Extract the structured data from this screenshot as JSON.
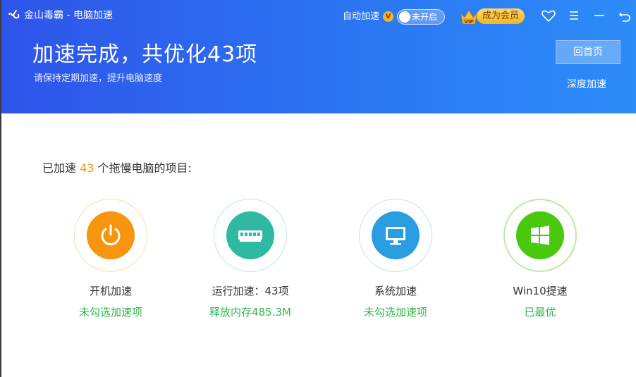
{
  "app": {
    "title": "金山毒霸 - 电脑加速"
  },
  "titlebar": {
    "auto_accelerate_label": "自动加速",
    "auto_vip_badge": "V",
    "toggle_state_label": "未开启",
    "vip_button_label": "成为会员",
    "vip_crown_text": "VIP"
  },
  "header": {
    "title": "加速完成，共优化43项",
    "subtitle": "请保持定期加速，提升电脑速度",
    "home_button": "回首页",
    "deep_accelerate": "深度加速"
  },
  "summary": {
    "prefix": "已加速 ",
    "count": "43",
    "suffix": " 个拖慢电脑的项目:"
  },
  "items": [
    {
      "name": "开机加速",
      "status": "未勾选加速项",
      "icon": "power-icon",
      "color": "#f7950e"
    },
    {
      "name": "运行加速：43项",
      "status": "释放内存485.3M",
      "icon": "memory-icon",
      "color": "#2fb9a2"
    },
    {
      "name": "系统加速",
      "status": "未勾选加速项",
      "icon": "monitor-icon",
      "color": "#2a9de0"
    },
    {
      "name": "Win10提速",
      "status": "已最优",
      "icon": "windows-icon",
      "color": "#49c80e"
    }
  ],
  "colors": {
    "header_gradient_start": "#2f54ea",
    "header_gradient_end": "#2d8cf8",
    "accent_orange": "#f39b16",
    "status_green": "#2cb84b"
  }
}
